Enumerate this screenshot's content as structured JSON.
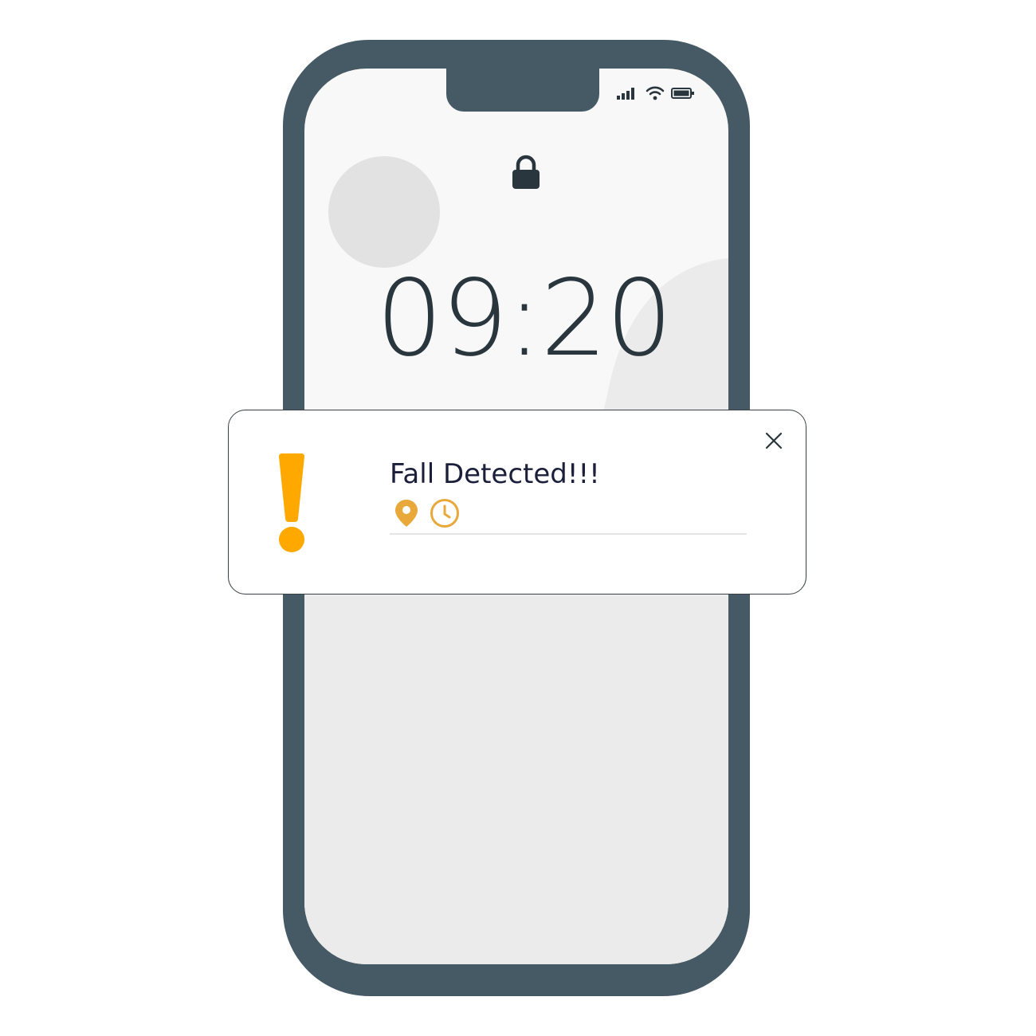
{
  "lockscreen": {
    "time": "09:20"
  },
  "status_bar": {
    "icons": [
      "signal-icon",
      "wifi-icon",
      "battery-icon"
    ]
  },
  "notification": {
    "title": "Fall Detected!!!",
    "icons": [
      "exclamation-icon",
      "location-pin-icon",
      "clock-icon",
      "close-icon"
    ]
  },
  "colors": {
    "phone_frame": "#465a66",
    "screen": "#f8f8f8",
    "accent_orange": "#ffa800",
    "accent_gold": "#e8a83a",
    "text_dark": "#2a363d"
  }
}
